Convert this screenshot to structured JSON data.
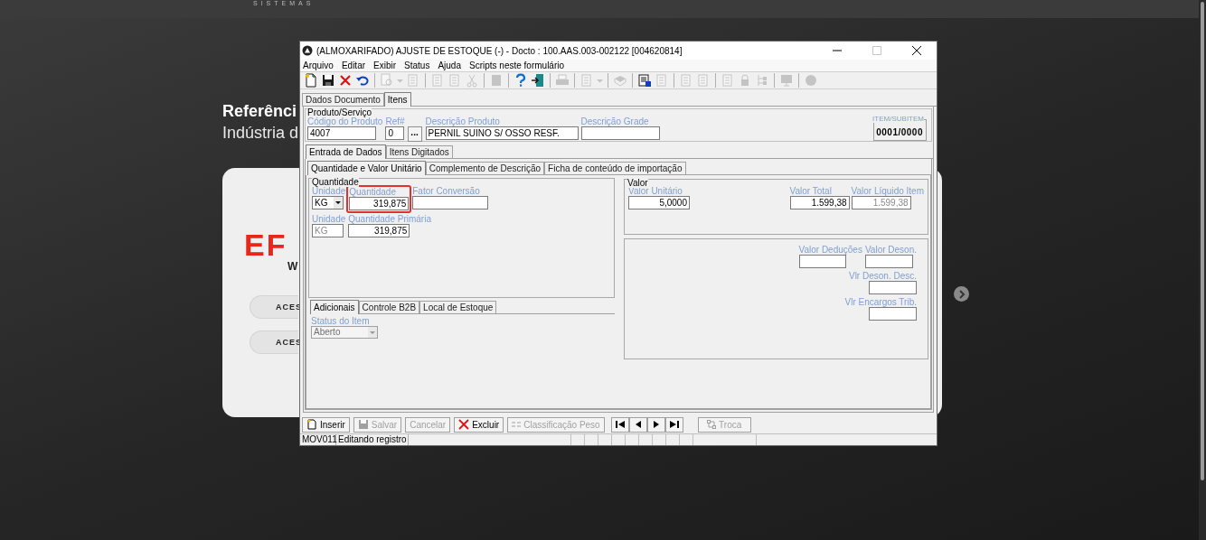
{
  "site": {
    "tagline": "SISTEMAS",
    "heading": "Referênci",
    "subheading": "Indústria d",
    "logo": "EF",
    "logo_sub": "W",
    "buttons": [
      "ACES",
      "ACES"
    ]
  },
  "window": {
    "title": "(ALMOXARIFADO) AJUSTE DE ESTOQUE (-) - Docto : 100.AAS.003-002122 [004620814]"
  },
  "menu": [
    "Arquivo",
    "Editar",
    "Exibir",
    "Status",
    "Ajuda",
    "Scripts neste formulário"
  ],
  "toolbar": [
    {
      "kind": "new",
      "disabled": false
    },
    {
      "kind": "save",
      "disabled": false
    },
    {
      "kind": "delete",
      "disabled": false
    },
    {
      "kind": "undo",
      "disabled": false
    },
    {
      "kind": "separator"
    },
    {
      "kind": "preview",
      "disabled": true
    },
    {
      "kind": "caret",
      "disabled": true
    },
    {
      "kind": "page",
      "disabled": true
    },
    {
      "kind": "separator"
    },
    {
      "kind": "page",
      "disabled": true
    },
    {
      "kind": "page",
      "disabled": true
    },
    {
      "kind": "cut",
      "disabled": true
    },
    {
      "kind": "separator"
    },
    {
      "kind": "block",
      "disabled": true
    },
    {
      "kind": "separator"
    },
    {
      "kind": "help",
      "disabled": false
    },
    {
      "kind": "exit",
      "disabled": false
    },
    {
      "kind": "separator"
    },
    {
      "kind": "printer",
      "disabled": true
    },
    {
      "kind": "separator"
    },
    {
      "kind": "page",
      "disabled": true
    },
    {
      "kind": "caret",
      "disabled": true
    },
    {
      "kind": "separator"
    },
    {
      "kind": "book",
      "disabled": true
    },
    {
      "kind": "separator"
    },
    {
      "kind": "report",
      "disabled": false
    },
    {
      "kind": "page",
      "disabled": true
    },
    {
      "kind": "separator"
    },
    {
      "kind": "page",
      "disabled": true
    },
    {
      "kind": "page",
      "disabled": true
    },
    {
      "kind": "separator"
    },
    {
      "kind": "page",
      "disabled": true
    },
    {
      "kind": "lock",
      "disabled": true
    },
    {
      "kind": "tree",
      "disabled": true
    },
    {
      "kind": "separator"
    },
    {
      "kind": "monitor",
      "disabled": true
    },
    {
      "kind": "separator"
    },
    {
      "kind": "circle",
      "disabled": true
    }
  ],
  "doc_tabs": [
    {
      "label": "Dados Documento",
      "selected": false
    },
    {
      "label": "Itens",
      "selected": true
    }
  ],
  "product": {
    "title": "Produto/Serviço",
    "fields": [
      {
        "label": "Código do Produto",
        "value": "4007"
      },
      {
        "label": "Ref#",
        "value": "0"
      },
      {
        "label": "Descrição Produto",
        "value": "PERNIL SUINO S/ OSSO RESF."
      },
      {
        "label": "Descrição Grade"
      }
    ],
    "lookup": "...",
    "counter_label": "ITEM/SUBITEM",
    "counter": "0001/0000"
  },
  "entry_tabs": [
    {
      "label": "Entrada de Dados",
      "selected": true
    },
    {
      "label": "Itens Digitados",
      "selected": false
    }
  ],
  "sub_tabs": [
    {
      "label": "Quantidade e Valor Unitário",
      "selected": true
    },
    {
      "label": "Complemento de Descrição",
      "selected": false
    },
    {
      "label": "Ficha de conteúdo de importação",
      "selected": false
    }
  ],
  "quantity": {
    "title": "Quantidade",
    "unit_label": "Unidade",
    "unit": "KG",
    "qty_label": "Quantidade",
    "qty": "319,875",
    "highlighted": true,
    "factor_label": "Fator Conversão",
    "primary_unit_label": "Unidade",
    "primary_unit": "KG",
    "primary_qty_label": "Quantidade Primária",
    "primary_qty": "319,875"
  },
  "value": {
    "title": "Valor",
    "fields": [
      {
        "label": "Valor Unitário",
        "value": "5,0000",
        "disabled": false
      },
      {
        "label": "Valor Total",
        "value": "1.599,38",
        "disabled": false
      },
      {
        "label": "Valor Líquido Item",
        "value": "1.599,38",
        "disabled": true
      }
    ]
  },
  "taxes": [
    "Valor Deduções",
    "Valor Deson.",
    "Vlr Deson. Desc.",
    "Vlr Encargos Trib."
  ],
  "extra_tabs": [
    {
      "label": "Adicionais",
      "selected": true
    },
    {
      "label": "Controle B2B",
      "selected": false
    },
    {
      "label": "Local de Estoque",
      "selected": false
    }
  ],
  "status_item": {
    "label": "Status do Item",
    "value": "Aberto",
    "disabled": true
  },
  "actions": [
    {
      "label": "Inserir",
      "kind": "insert",
      "disabled": false
    },
    {
      "label": "Salvar",
      "kind": "save",
      "disabled": true
    },
    {
      "label": "Cancelar",
      "kind": "cancel",
      "disabled": true
    },
    {
      "label": "Excluir",
      "kind": "delete",
      "disabled": false
    },
    {
      "label": "Classificação Peso",
      "kind": "weight",
      "disabled": true
    }
  ],
  "nav": [
    {
      "kind": "first"
    },
    {
      "kind": "prev"
    },
    {
      "kind": "next"
    },
    {
      "kind": "last"
    }
  ],
  "swap": {
    "label": "Troca",
    "disabled": true
  },
  "status_bar": [
    "MOV011",
    "Editando registro"
  ]
}
